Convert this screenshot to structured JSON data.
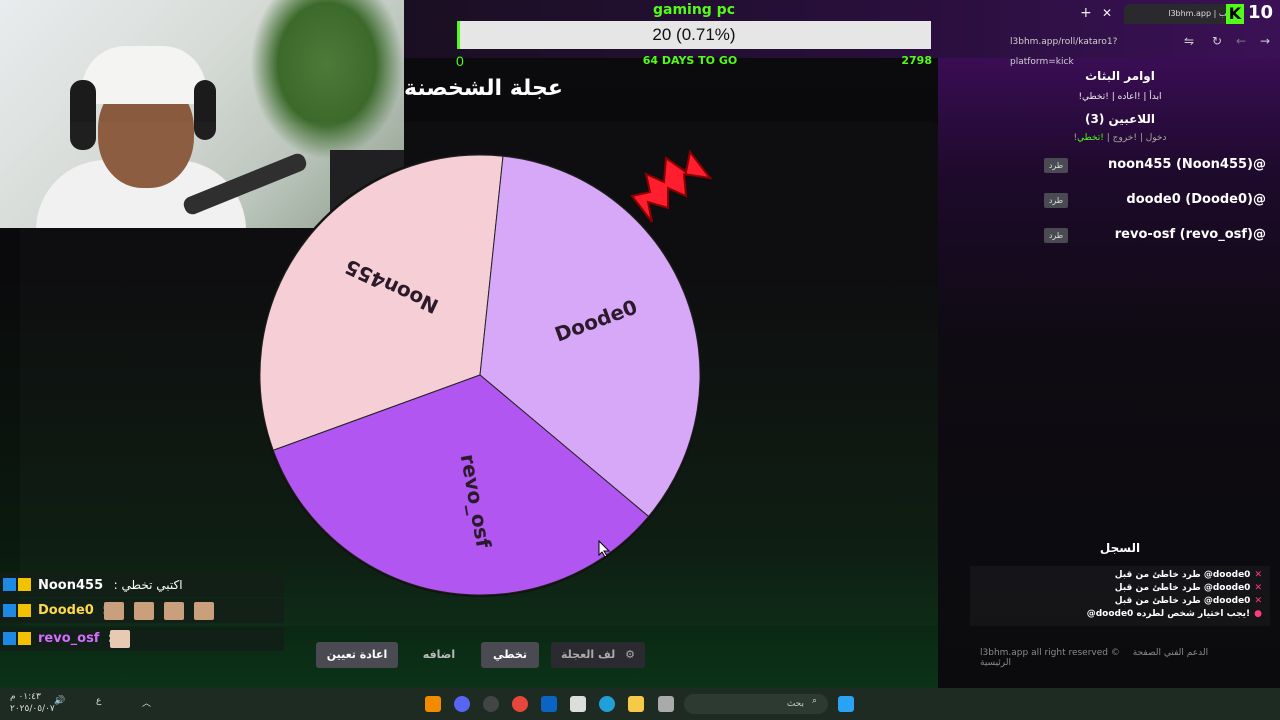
{
  "overlay": {
    "goal": {
      "title": "gaming pc",
      "value_text": "20 (0.71%)",
      "progress_fraction": 0.0071,
      "min": "0",
      "days": "64 DAYS TO GO",
      "max": "2798"
    },
    "kick_count": "10",
    "kick_logo": "K"
  },
  "browser": {
    "tab_title": "l3bhm.app | ترتيب",
    "url": "l3bhm.app/roll/kataro1?platform=kick",
    "new_tab": "+",
    "close_tab": "✕"
  },
  "page": {
    "title": "عجلة الشخصنة"
  },
  "wheel": {
    "segments": [
      {
        "label": "Noon455",
        "color": "#f6cfd6"
      },
      {
        "label": "Doode0",
        "color": "#d8a8f8"
      },
      {
        "label": "revo_osf",
        "color": "#b156f0"
      }
    ]
  },
  "right_panel": {
    "commands_title": "اوامر البثاث",
    "commands": "!ابدأ | !اعاده | !تخطي",
    "players_title": "اللاعبين (3)",
    "actions": {
      "join": "!دخول",
      "leave": "!خروج",
      "skip": "!تخطي"
    },
    "players": [
      {
        "name": "noon455 (Noon455)@",
        "kick": "طرد"
      },
      {
        "name": "doode0 (Doode0)@",
        "kick": "طرد"
      },
      {
        "name": "revo-osf (revo_osf)@",
        "kick": "طرد"
      }
    ],
    "log_title": "السجل",
    "log": [
      "طرد خاطئ من قبل @doode0",
      "طرد خاطئ من قبل @doode0",
      "طرد خاطئ من قبل @doode0",
      "@doode0 يجب اختيار شخص لطرده!"
    ]
  },
  "footer": {
    "home": "الصفحة الرئيسية",
    "support": "الدعم الفني",
    "rights": "l3bhm.app all right reserved ©"
  },
  "buttons": {
    "spin": "لف العجلة",
    "skip": "تخطي",
    "add": "اضافه",
    "reset": "اعادة تعيين"
  },
  "chat": [
    {
      "name": "Noon455",
      "message": ": اكتبي تخطي",
      "color": "#ffffff"
    },
    {
      "name": "Doode0",
      "message": ":",
      "color": "#ffd84a"
    },
    {
      "name": "revo_osf",
      "message": ":",
      "color": "#d36cff"
    }
  ],
  "taskbar": {
    "search": "بحث",
    "time": "٠١:٤٣ م",
    "date": "٢٠٢٥/٠٥/٠٧",
    "lang": "ع"
  },
  "colors": {
    "accent": "#53fc18",
    "kick_green": "#53fc18"
  }
}
